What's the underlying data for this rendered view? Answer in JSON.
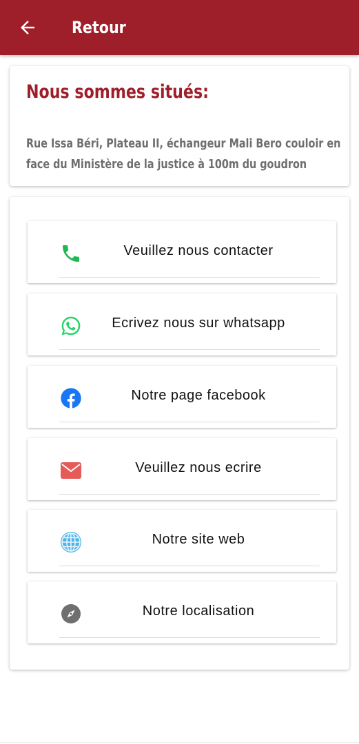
{
  "appbar": {
    "title": "Retour",
    "color": "#9e1f2a"
  },
  "address": {
    "title": "Nous sommes situés:",
    "text": "Rue Issa Béri, Plateau II, échangeur Mali Bero couloir en face du Ministère de la justice à 100m du goudron"
  },
  "contacts": [
    {
      "label": "Veuillez nous contacter",
      "icon": "phone-icon",
      "color": "#1db954"
    },
    {
      "label": "Ecrivez nous sur whatsapp",
      "icon": "whatsapp-icon",
      "color": "#25d366"
    },
    {
      "label": "Notre page facebook",
      "icon": "facebook-icon",
      "color": "#1877f2"
    },
    {
      "label": "Veuillez nous ecrire",
      "icon": "mail-icon",
      "color": "#e45b57"
    },
    {
      "label": "Notre site web",
      "icon": "globe-icon",
      "color": "#4fb3e8"
    },
    {
      "label": "Notre localisation",
      "icon": "compass-icon",
      "color": "#6f6f6f"
    }
  ]
}
